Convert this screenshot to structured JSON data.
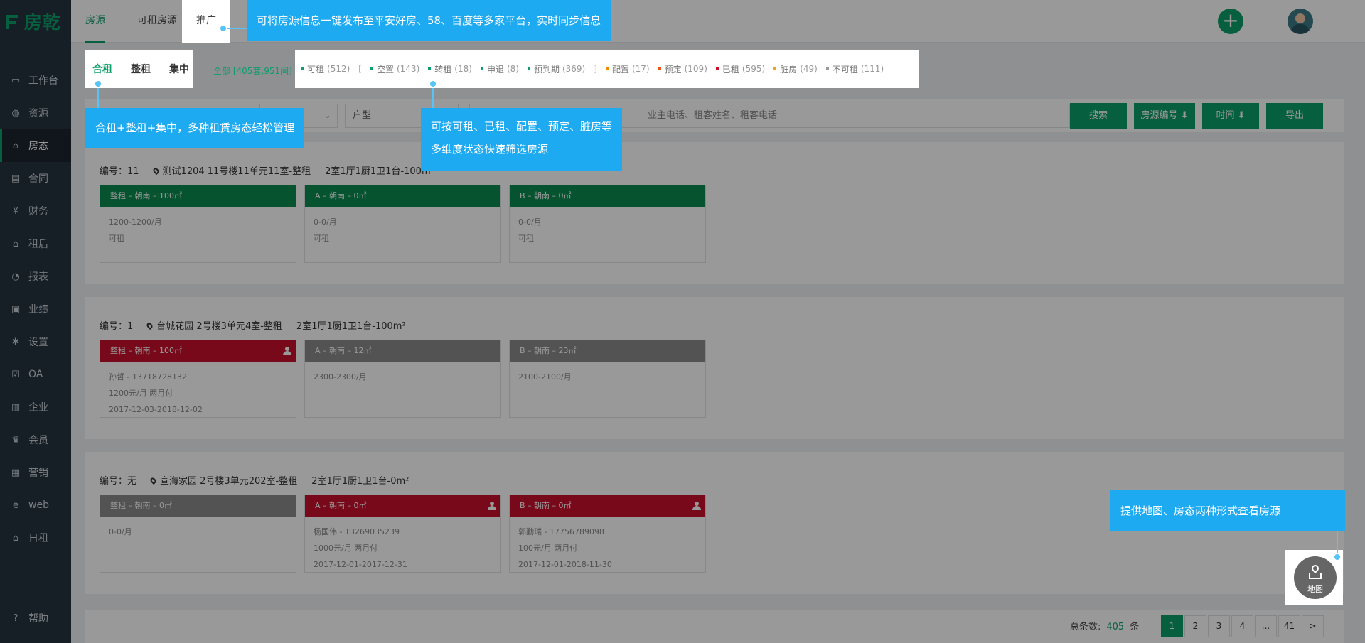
{
  "app": {
    "logo_text": "房乾"
  },
  "sidebar": {
    "items": [
      {
        "label": "工作台",
        "icon": "monitor-icon"
      },
      {
        "label": "资源",
        "icon": "database-icon"
      },
      {
        "label": "房态",
        "icon": "home-icon"
      },
      {
        "label": "合同",
        "icon": "contract-icon"
      },
      {
        "label": "财务",
        "icon": "yen-icon"
      },
      {
        "label": "租后",
        "icon": "home-icon"
      },
      {
        "label": "报表",
        "icon": "pie-chart-icon"
      },
      {
        "label": "业绩",
        "icon": "image-chart-icon"
      },
      {
        "label": "设置",
        "icon": "gear-icon"
      },
      {
        "label": "OA",
        "icon": "checkbox-icon"
      },
      {
        "label": "企业",
        "icon": "document-icon"
      },
      {
        "label": "会员",
        "icon": "crown-icon"
      },
      {
        "label": "营销",
        "icon": "gift-icon"
      },
      {
        "label": "web",
        "icon": "e-icon"
      },
      {
        "label": "日租",
        "icon": "home-icon"
      }
    ],
    "help_label": "帮助"
  },
  "topbar": {
    "tabs": [
      "房源",
      "可租房源",
      "推广"
    ]
  },
  "rent_types": [
    "合租",
    "整租",
    "集中"
  ],
  "status": {
    "all_label": "全部 [405套,951间]",
    "items": [
      {
        "label": "可租",
        "count": "(512)",
        "color": "#0b9e6a"
      },
      {
        "label": "空置",
        "count": "(143)",
        "color": "#0b9e6a"
      },
      {
        "label": "转租",
        "count": "(18)",
        "color": "#0b9e6a"
      },
      {
        "label": "申退",
        "count": "(8)",
        "color": "#0b9e6a"
      },
      {
        "label": "预到期",
        "count": "(369)",
        "color": "#0b9e6a"
      },
      {
        "label": "配置",
        "count": "(17)",
        "color": "#f08c00"
      },
      {
        "label": "预定",
        "count": "(109)",
        "color": "#e8550e"
      },
      {
        "label": "已租",
        "count": "(595)",
        "color": "#c8102e"
      },
      {
        "label": "脏房",
        "count": "(49)",
        "color": "#f0a020"
      },
      {
        "label": "不可租",
        "count": "(111)",
        "color": "#9a9a9a"
      }
    ],
    "bracket_open": "[",
    "bracket_close": "]"
  },
  "filters": {
    "select1_arrow": "⌄",
    "room_type_placeholder": "户型",
    "search_placeholder": "业主电话、租客姓名、租客电话",
    "search_button": "搜索",
    "sort_number": "房源编号 ⬇",
    "sort_time": "时间 ⬇",
    "export_button": "导出"
  },
  "properties": [
    {
      "number": "编号：11",
      "address": "测试1204 11号楼11单元11室-整租",
      "layout": "2室1厅1厨1卫1台-100m²",
      "rooms": [
        {
          "header": "整租 – 朝南 – 100㎡",
          "lines": [
            "1200-1200/月",
            "可租"
          ],
          "tone": "g",
          "tenant": false
        },
        {
          "header": "A – 朝南 – 0㎡",
          "lines": [
            "0-0/月",
            "可租"
          ],
          "tone": "g",
          "tenant": false
        },
        {
          "header": "B – 朝南 – 0㎡",
          "lines": [
            "0-0/月",
            "可租"
          ],
          "tone": "g",
          "tenant": false
        }
      ]
    },
    {
      "number": "编号：1",
      "address": "台城花园 2号楼3单元4室-整租",
      "layout": "2室1厅1厨1卫1台-100m²",
      "rooms": [
        {
          "header": "整租 – 朝南 – 100㎡",
          "lines": [
            "孙哲 - 13718728132",
            "1200元/月   两月付",
            "2017-12-03-2018-12-02"
          ],
          "tone": "r",
          "tenant": true
        },
        {
          "header": "A – 朝南 – 12㎡",
          "lines": [
            "2300-2300/月"
          ],
          "tone": "gr",
          "tenant": false
        },
        {
          "header": "B – 朝南 – 23㎡",
          "lines": [
            "2100-2100/月"
          ],
          "tone": "gr",
          "tenant": false
        }
      ]
    },
    {
      "number": "编号：无",
      "address": "宣海家园 2号楼3单元202室-整租",
      "layout": "2室1厅1厨1卫1台-0m²",
      "rooms": [
        {
          "header": "整租 – 朝南 – 0㎡",
          "lines": [
            "0-0/月"
          ],
          "tone": "gr",
          "tenant": false
        },
        {
          "header": "A – 朝南 – 0㎡",
          "lines": [
            "杨国伟 - 13269035239",
            "1000元/月   两月付",
            "2017-12-01-2017-12-31"
          ],
          "tone": "r",
          "tenant": true
        },
        {
          "header": "B – 朝南 – 0㎡",
          "lines": [
            "郭勤瑞 - 17756789098",
            "100元/月   两月付",
            "2017-12-01-2018-11-30"
          ],
          "tone": "r",
          "tenant": true
        }
      ]
    }
  ],
  "pagination": {
    "total_prefix": "总条数:",
    "total": "405",
    "total_suffix": "条",
    "pages": [
      "1",
      "2",
      "3",
      "4",
      "...",
      "41",
      ">"
    ],
    "current": "1"
  },
  "map_button": {
    "label": "地图"
  },
  "tips": {
    "promote": "可将房源信息一键发布至平安好房、58、百度等多家平台，实时同步信息",
    "rent_types": "合租+整租+集中，多种租赁房态轻松管理",
    "status": [
      "可按可租、已租、配置、预定、脏房等",
      "多维度状态快速筛选房源"
    ],
    "map": "提供地图、房态两种形式查看房源"
  }
}
